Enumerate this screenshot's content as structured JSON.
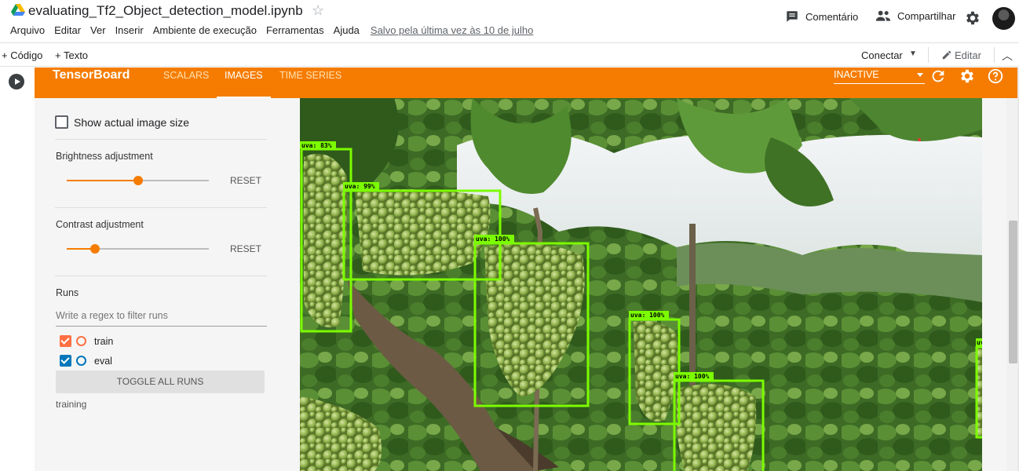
{
  "notebook": {
    "title": "evaluating_Tf2_Object_detection_model.ipynb",
    "menu": [
      "Arquivo",
      "Editar",
      "Ver",
      "Inserir",
      "Ambiente de execução",
      "Ferramentas",
      "Ajuda"
    ],
    "saved_status": "Salvo pela última vez às 10 de julho",
    "comment_label": "Comentário",
    "share_label": "Compartilhar"
  },
  "toolbar": {
    "add_code": "+ Código",
    "add_text": "+ Texto",
    "connect": "Conectar",
    "edit": "Editar"
  },
  "tensorboard": {
    "brand": "TensorBoard",
    "tabs": [
      {
        "label": "SCALARS",
        "active": false
      },
      {
        "label": "IMAGES",
        "active": true
      },
      {
        "label": "TIME SERIES",
        "active": false
      }
    ],
    "status_select": "INACTIVE",
    "accent_color": "#f57c00"
  },
  "sidebar": {
    "show_actual_size": "Show actual image size",
    "show_actual_size_checked": false,
    "brightness_label": "Brightness adjustment",
    "brightness_value": 0.5,
    "contrast_label": "Contrast adjustment",
    "contrast_value": 0.2,
    "reset_label": "RESET",
    "runs_label": "Runs",
    "regex_placeholder": "Write a regex to filter runs",
    "runs": [
      {
        "name": "train",
        "checked": true,
        "color": "#ff7043"
      },
      {
        "name": "eval",
        "checked": true,
        "color": "#0077bb"
      }
    ],
    "toggle_all": "TOGGLE ALL RUNS",
    "current_tag": "training"
  },
  "detections": [
    {
      "label": "uva: 83%"
    },
    {
      "label": "uva: 99%"
    },
    {
      "label": "uva: 100%"
    },
    {
      "label": "uva: 100%"
    },
    {
      "label": "uva: 100%"
    },
    {
      "label": "uva"
    }
  ]
}
